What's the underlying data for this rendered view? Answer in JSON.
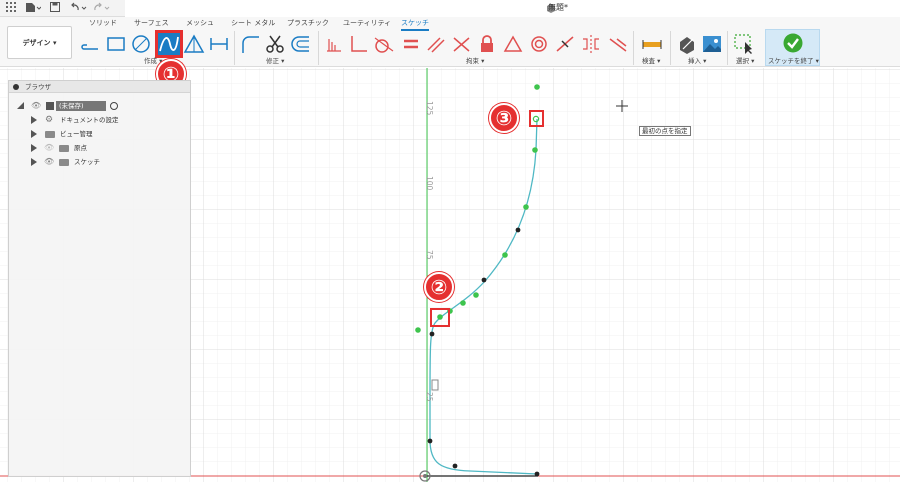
{
  "titlebar": {
    "grid_icon": "grid-icon",
    "file_icon": "file-icon",
    "save_icon": "save-icon",
    "undo_icon": "undo-icon",
    "redo_icon": "redo-icon",
    "document_title": "無題*"
  },
  "ribbon": {
    "workspace_button": "デザイン ▾",
    "tabs": [
      "ソリッド",
      "サーフェス",
      "メッシュ",
      "シート メタル",
      "プラスチック",
      "ユーティリティ",
      "スケッチ"
    ],
    "active_tab": "スケッチ",
    "groups": {
      "create": "作成 ▾",
      "modify": "修正 ▾",
      "constraints": "拘束 ▾",
      "inspect": "検査 ▾",
      "insert": "挿入 ▾",
      "select": "選択 ▾",
      "finish": "スケッチを終了 ▾"
    }
  },
  "browser": {
    "title": "ブラウザ",
    "root": "(未保存)",
    "items": [
      "ドキュメントの設定",
      "ビュー管理",
      "原点",
      "スケッチ"
    ]
  },
  "canvas": {
    "axis_labels": [
      "125",
      "100",
      "75",
      "25"
    ],
    "callout": "最初の点を指定"
  },
  "annotations": {
    "markers": [
      "①",
      "②",
      "③"
    ]
  },
  "colors": {
    "accent": "#1a7cc4",
    "marker_red": "#e53030",
    "spline": "#4fb8c4",
    "point_green": "#3ec44d",
    "y_axis": "#3ec44d",
    "x_axis": "#e05050",
    "finish_check": "#3aa832"
  }
}
